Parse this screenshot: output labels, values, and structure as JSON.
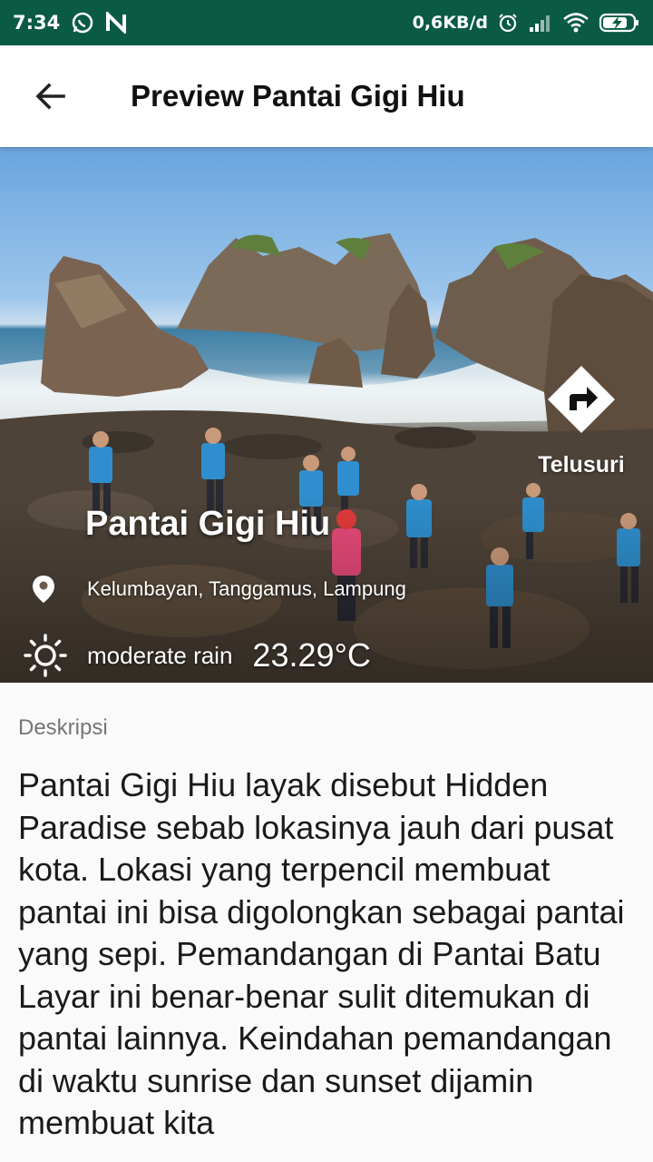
{
  "status_bar": {
    "time": "7:34",
    "data_rate": "0,6KB/d",
    "icons": [
      "whatsapp-icon",
      "n-icon",
      "alarm-icon",
      "signal-icon",
      "wifi-icon",
      "battery-icon"
    ]
  },
  "app_bar": {
    "title": "Preview Pantai Gigi Hiu",
    "back_icon": "arrow-back-icon"
  },
  "hero": {
    "place_name": "Pantai Gigi Hiu",
    "location": "Kelumbayan, Tanggamus, Lampung",
    "weather_desc": "moderate rain",
    "temperature": "23.29°C",
    "explore_label": "Telusuri",
    "explore_icon": "directions-icon"
  },
  "description": {
    "label": "Deskripsi",
    "text": "Pantai Gigi Hiu layak disebut Hidden Paradise sebab lokasinya jauh dari pusat kota. Lokasi yang terpencil membuat pantai ini bisa digolongkan sebagai pantai yang sepi. Pemandangan di Pantai Batu Layar ini benar-benar sulit ditemukan di pantai lainnya. Keindahan pemandangan di waktu sunrise dan sunset dijamin membuat kita"
  },
  "colors": {
    "status_bar_bg": "#0a5a44",
    "app_bar_bg": "#ffffff",
    "text_primary": "#1a1a1a",
    "text_secondary": "#757575"
  }
}
